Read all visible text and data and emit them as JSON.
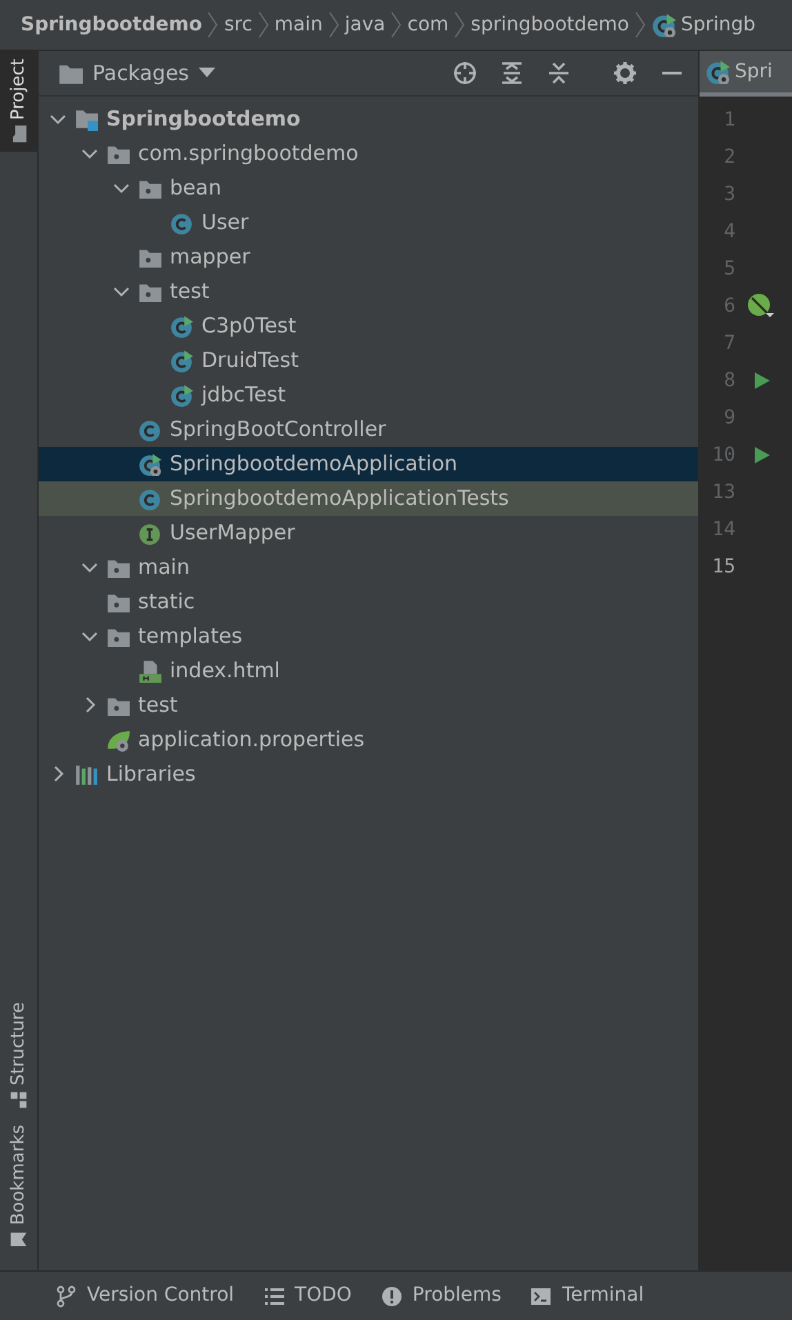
{
  "breadcrumbs": [
    {
      "label": "Springbootdemo",
      "kind": "project"
    },
    {
      "label": "src",
      "kind": "folder"
    },
    {
      "label": "main",
      "kind": "folder"
    },
    {
      "label": "java",
      "kind": "folder"
    },
    {
      "label": "com",
      "kind": "folder"
    },
    {
      "label": "springbootdemo",
      "kind": "folder"
    },
    {
      "label": "Springb",
      "kind": "appclass"
    }
  ],
  "left_strip": [
    {
      "label": "Project",
      "kind": "folder",
      "selected": true
    },
    {
      "label": "Structure",
      "kind": "structure",
      "selected": false
    },
    {
      "label": "Bookmarks",
      "kind": "bookmark",
      "selected": false
    }
  ],
  "panel": {
    "title": "Packages"
  },
  "tree": [
    {
      "label": "Springbootdemo",
      "kind": "module",
      "bold": true,
      "expanded": true,
      "selected": false,
      "hovered": false,
      "children": [
        {
          "label": "com.springbootdemo",
          "kind": "package",
          "expanded": true,
          "selected": false,
          "hovered": false,
          "children": [
            {
              "label": "bean",
              "kind": "package",
              "expanded": true,
              "selected": false,
              "hovered": false,
              "children": [
                {
                  "label": "User",
                  "kind": "class",
                  "selected": false,
                  "hovered": false
                }
              ]
            },
            {
              "label": "mapper",
              "kind": "package",
              "selected": false,
              "hovered": false
            },
            {
              "label": "test",
              "kind": "package",
              "expanded": true,
              "selected": false,
              "hovered": false,
              "children": [
                {
                  "label": "C3p0Test",
                  "kind": "testclass",
                  "selected": false,
                  "hovered": false
                },
                {
                  "label": "DruidTest",
                  "kind": "testclass",
                  "selected": false,
                  "hovered": false
                },
                {
                  "label": "jdbcTest",
                  "kind": "testclass",
                  "selected": false,
                  "hovered": false
                }
              ]
            },
            {
              "label": "SpringBootController",
              "kind": "class",
              "selected": false,
              "hovered": false
            },
            {
              "label": "SpringbootdemoApplication",
              "kind": "appclass",
              "selected": true,
              "hovered": false
            },
            {
              "label": "SpringbootdemoApplicationTests",
              "kind": "class",
              "selected": false,
              "hovered": true
            },
            {
              "label": "UserMapper",
              "kind": "interface",
              "selected": false,
              "hovered": false
            }
          ]
        },
        {
          "label": "main",
          "kind": "package",
          "expanded": true,
          "selected": false,
          "hovered": false
        },
        {
          "label": "static",
          "kind": "package",
          "selected": false,
          "hovered": false
        },
        {
          "label": "templates",
          "kind": "package",
          "expanded": true,
          "selected": false,
          "hovered": false,
          "children": [
            {
              "label": "index.html",
              "kind": "html",
              "selected": false,
              "hovered": false
            }
          ]
        },
        {
          "label": "test",
          "kind": "package",
          "expanded": false,
          "selected": false,
          "hovered": false
        },
        {
          "label": "application.properties",
          "kind": "properties",
          "selected": false,
          "hovered": false
        }
      ]
    },
    {
      "label": "Libraries",
      "kind": "libraries",
      "expanded": false,
      "selected": false,
      "hovered": false
    }
  ],
  "editor": {
    "tab": {
      "label": "Spri",
      "kind": "appclass"
    },
    "lines": [
      {
        "number": "1",
        "current": false
      },
      {
        "number": "2",
        "current": false
      },
      {
        "number": "3",
        "current": false
      },
      {
        "number": "4",
        "current": false
      },
      {
        "number": "5",
        "current": false
      },
      {
        "number": "6",
        "kind": "spring",
        "current": false
      },
      {
        "number": "7",
        "current": false
      },
      {
        "number": "8",
        "kind": "run",
        "current": false
      },
      {
        "number": "9",
        "current": false
      },
      {
        "number": "10",
        "kind": "run",
        "current": false
      },
      {
        "number": "13",
        "current": false
      },
      {
        "number": "14",
        "current": false
      },
      {
        "number": "15",
        "current": true
      }
    ]
  },
  "bottom_tools": [
    {
      "label": "Version Control",
      "kind": "branch"
    },
    {
      "label": "TODO",
      "kind": "list"
    },
    {
      "label": "Problems",
      "kind": "problems"
    },
    {
      "label": "Terminal",
      "kind": "terminal"
    }
  ]
}
